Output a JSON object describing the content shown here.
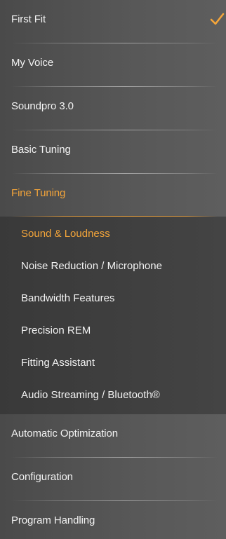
{
  "menu": {
    "items": [
      {
        "label": "First Fit"
      },
      {
        "label": "My Voice"
      },
      {
        "label": "Soundpro 3.0"
      },
      {
        "label": "Basic Tuning"
      },
      {
        "label": "Fine Tuning"
      },
      {
        "label": "Automatic Optimization"
      },
      {
        "label": "Configuration"
      },
      {
        "label": "Program Handling"
      }
    ],
    "sub_items": [
      {
        "label": "Sound & Loudness"
      },
      {
        "label": "Noise Reduction / Microphone"
      },
      {
        "label": "Bandwidth Features"
      },
      {
        "label": "Precision REM"
      },
      {
        "label": "Fitting Assistant"
      },
      {
        "label": "Audio Streaming / Bluetooth®"
      }
    ],
    "completed_icon": "checkmark-icon",
    "active_item": "Fine Tuning",
    "selected_sub_item": "Sound & Loudness"
  },
  "colors": {
    "accent": "#f4a53a",
    "text": "#f2f2f2",
    "panel": "#4a4a4a",
    "sub_panel": "#3d3d3d"
  }
}
